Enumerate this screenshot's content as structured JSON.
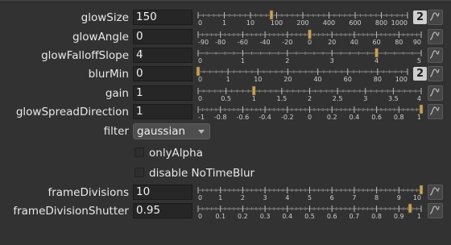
{
  "params": [
    {
      "id": "glowSize",
      "label": "glowSize",
      "value": "150",
      "ticks": [
        "0",
        "1",
        "10",
        "100",
        "200",
        "400",
        "600",
        "800",
        "1000"
      ],
      "fraction": 0.35,
      "badge": "2"
    },
    {
      "id": "glowAngle",
      "label": "glowAngle",
      "value": "0",
      "ticks": [
        "-90",
        "-80",
        "-60",
        "-40",
        "-20",
        "0",
        "20",
        "40",
        "60",
        "80",
        "90"
      ],
      "fraction": 0.5
    },
    {
      "id": "glowFalloffSlope",
      "label": "glowFalloffSlope",
      "value": "4",
      "ticks": [
        "0",
        "1",
        "2",
        "3",
        "4",
        "5"
      ],
      "fraction": 0.8
    },
    {
      "id": "blurMin",
      "label": "blurMin",
      "value": "0",
      "ticks": [
        "0",
        "1",
        "10",
        "20",
        "40",
        "60",
        "80",
        "100"
      ],
      "fraction": 0.0,
      "badge": "2"
    },
    {
      "id": "gain",
      "label": "gain",
      "value": "1",
      "ticks": [
        "0",
        "0.5",
        "1",
        "1.5",
        "2",
        "2.5",
        "3",
        "3.5",
        "4"
      ],
      "fraction": 0.25
    },
    {
      "id": "glowSpreadDirection",
      "label": "glowSpreadDirection",
      "value": "1",
      "ticks": [
        "-1",
        "-0.8",
        "-0.6",
        "-0.4",
        "-0.2",
        "0",
        "0.2",
        "0.4",
        "0.6",
        "0.8",
        "1"
      ],
      "fraction": 1.0
    }
  ],
  "filter": {
    "label": "filter",
    "value": "gaussian"
  },
  "checkboxes": [
    {
      "label": "onlyAlpha",
      "checked": false
    },
    {
      "label": "disable NoTimeBlur",
      "checked": false
    }
  ],
  "params2": [
    {
      "id": "frameDivisions",
      "label": "frameDivisions",
      "value": "10",
      "ticks": [
        "0",
        "1",
        "2",
        "3",
        "4",
        "5",
        "6",
        "7",
        "8",
        "9",
        "10"
      ],
      "fraction": 1.0
    },
    {
      "id": "frameDivisionShutter",
      "label": "frameDivisionShutter",
      "value": "0.95",
      "ticks": [
        "0",
        "0.1",
        "0.2",
        "0.3",
        "0.4",
        "0.5",
        "0.6",
        "0.7",
        "0.8",
        "0.9",
        "1"
      ],
      "fraction": 0.95
    }
  ],
  "colors": {
    "background": "#323232",
    "field": "#262626",
    "handle": "#c8a25c",
    "badge": "#d0d0d0"
  },
  "icons": {
    "curve": "animation-curve-icon",
    "dropdown": "chevron-down-icon"
  }
}
